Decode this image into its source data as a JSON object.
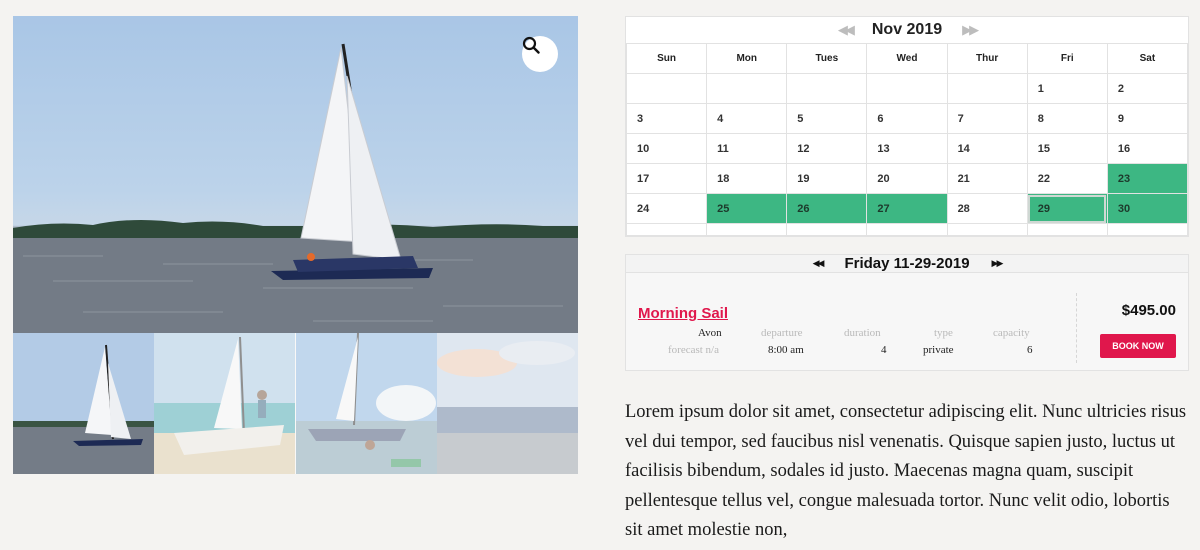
{
  "gallery": {
    "zoom_icon": "magnifier-icon",
    "thumbnails": [
      {
        "name": "thumb-sailboat",
        "faded": false
      },
      {
        "name": "thumb-beach-boat",
        "faded": true
      },
      {
        "name": "thumb-launch",
        "faded": true
      },
      {
        "name": "thumb-sunset-beach",
        "faded": true
      }
    ]
  },
  "calendar": {
    "prev_icon": "double-left-arrow-icon",
    "next_icon": "double-right-arrow-icon",
    "prev": "◀◀",
    "next": "▶▶",
    "month": "Nov 2019",
    "weekdays": [
      "Sun",
      "Mon",
      "Tues",
      "Wed",
      "Thur",
      "Fri",
      "Sat"
    ],
    "weeks": [
      [
        "",
        "",
        "",
        "",
        "",
        "1",
        "2"
      ],
      [
        "3",
        "4",
        "5",
        "6",
        "7",
        "8",
        "9"
      ],
      [
        "10",
        "11",
        "12",
        "13",
        "14",
        "15",
        "16"
      ],
      [
        "17",
        "18",
        "19",
        "20",
        "21",
        "22",
        "23"
      ],
      [
        "24",
        "25",
        "26",
        "27",
        "28",
        "29",
        "30"
      ]
    ],
    "available_days": [
      "23",
      "25",
      "26",
      "27",
      "29",
      "30"
    ],
    "selected_day": "29",
    "available_color": "#3db783"
  },
  "day_panel": {
    "prev": "◀◀",
    "next": "▶▶",
    "title": "Friday 11-29-2019",
    "trip": {
      "name": "Morning Sail",
      "location": "Avon",
      "forecast": "forecast n/a",
      "departure_label": "departure",
      "departure": "8:00 am",
      "duration_label": "duration",
      "duration": "4",
      "type_label": "type",
      "type": "private",
      "capacity_label": "capacity",
      "capacity": "6",
      "price": "$495.00",
      "book_label": "BOOK NOW",
      "accent_color": "#e0174c"
    }
  },
  "description": "Lorem ipsum dolor sit amet, consectetur adipiscing elit. Nunc ultricies risus vel dui tempor, sed faucibus nisl venenatis. Quisque sapien justo, luctus ut facilisis bibendum, sodales id justo. Maecenas magna quam, suscipit pellentesque tellus vel, congue malesuada tortor. Nunc velit odio, lobortis sit amet molestie non,"
}
